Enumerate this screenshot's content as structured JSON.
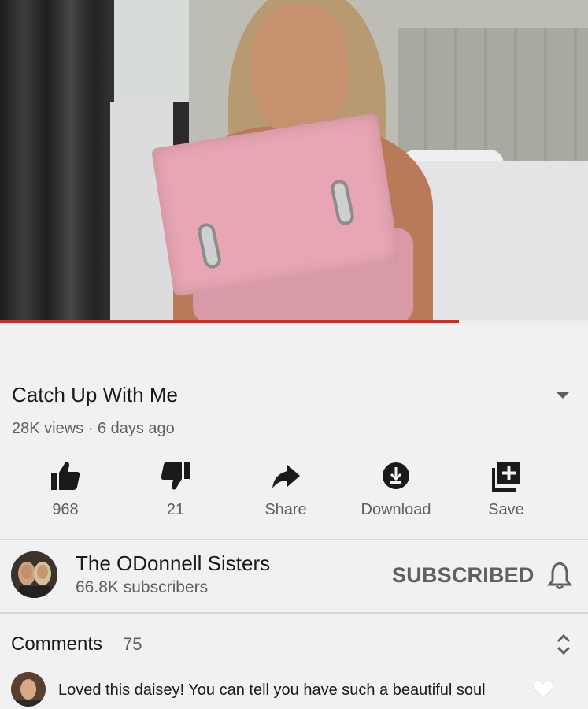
{
  "video": {
    "progress_fraction": 0.78
  },
  "info": {
    "title": "Catch Up With Me",
    "meta": "28K views · 6 days ago"
  },
  "actions": [
    {
      "icon": "thumbs-up-icon",
      "label": "968"
    },
    {
      "icon": "thumbs-down-icon",
      "label": "21"
    },
    {
      "icon": "share-icon",
      "label": "Share"
    },
    {
      "icon": "download-icon",
      "label": "Download"
    },
    {
      "icon": "add-to-playlist-icon",
      "label": "Save"
    }
  ],
  "channel": {
    "name": "The ODonnell Sisters",
    "subscribers": "66.8K subscribers",
    "subscribe_label": "SUBSCRIBED"
  },
  "comments": {
    "title": "Comments",
    "count": "75",
    "first_comment": "Loved this daisey! You can tell you have such a beautiful soul"
  },
  "colors": {
    "background": "#f1f1f1",
    "progress": "#e62117",
    "secondary_text": "#606060"
  }
}
